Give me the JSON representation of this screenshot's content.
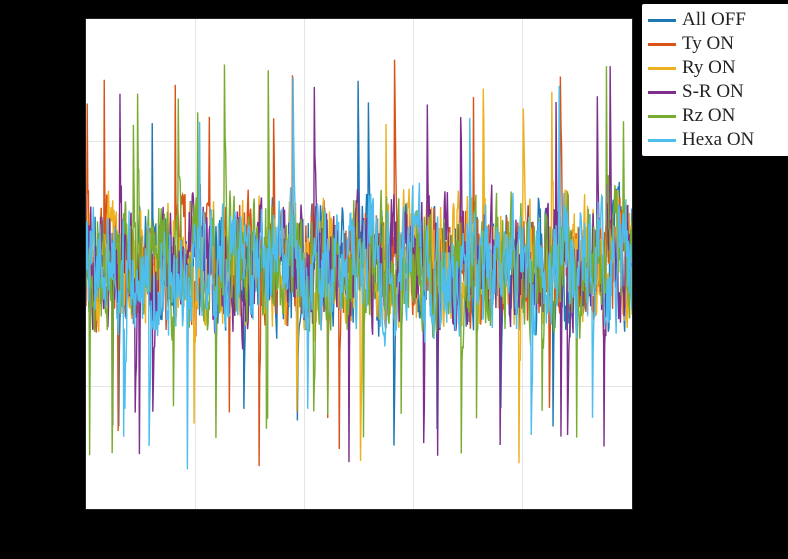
{
  "chart_data": {
    "type": "line",
    "description": "Dense overlapping time-series noise traces for six controller ON/OFF states. Exact numeric values are not readable from the plot; each trace is band-limited noise roughly spanning the central 60–70% of the vertical axis with occasional spikes.",
    "series": [
      {
        "name": "All OFF",
        "color": "#1f77b4"
      },
      {
        "name": "Ty ON",
        "color": "#d95319"
      },
      {
        "name": "Ry ON",
        "color": "#edb120"
      },
      {
        "name": "S-R ON",
        "color": "#7e2f8e"
      },
      {
        "name": "Rz ON",
        "color": "#77ac30"
      },
      {
        "name": "Hexa ON",
        "color": "#4dbeee"
      }
    ],
    "x_ticks_fraction": [
      0,
      0.2,
      0.4,
      0.6,
      0.8,
      1.0
    ],
    "y_ticks_fraction": [
      0,
      0.25,
      0.5,
      0.75,
      1.0
    ]
  },
  "legend": {
    "items": [
      {
        "label": "All OFF",
        "color": "#1f77b4"
      },
      {
        "label": "Ty ON",
        "color": "#d95319"
      },
      {
        "label": "Ry ON",
        "color": "#edb120"
      },
      {
        "label": "S-R ON",
        "color": "#7e2f8e"
      },
      {
        "label": "Rz ON",
        "color": "#77ac30"
      },
      {
        "label": "Hexa ON",
        "color": "#4dbeee"
      }
    ]
  },
  "icons": {
    "legend_line": "—"
  }
}
